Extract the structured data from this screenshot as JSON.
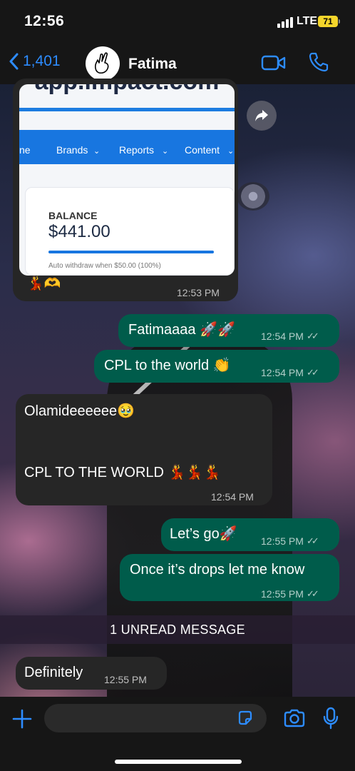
{
  "status_bar": {
    "time": "12:56",
    "network": "LTE",
    "battery": "71"
  },
  "header": {
    "back_count": "1,401",
    "contact_name": "Fatima"
  },
  "image_message": {
    "url_text": "app.impact.com",
    "nav": [
      "ne",
      "Brands",
      "Reports",
      "Content"
    ],
    "balance_label": "BALANCE",
    "balance_amount": "$441.00",
    "auto_withdraw": "Auto withdraw when $50.00 (100%)",
    "balance_progress": 1.0,
    "caption_emoji": "💃🫶",
    "time": "12:53 PM"
  },
  "messages": [
    {
      "dir": "out",
      "text": "Fatimaaaa 🚀🚀",
      "time": "12:54 PM"
    },
    {
      "dir": "out",
      "text": "CPL to the world 👏",
      "time": "12:54 PM"
    },
    {
      "dir": "in",
      "text": "Olamideeeeee🥹",
      "text2": "CPL TO THE WORLD 💃💃💃",
      "time": "12:54 PM"
    },
    {
      "dir": "out",
      "text": "Let’s go🚀",
      "time": "12:55 PM"
    },
    {
      "dir": "out",
      "text": "Once it’s drops let me know",
      "time": "12:55 PM"
    },
    {
      "dir": "in",
      "text": "Definitely",
      "time": "12:55 PM"
    }
  ],
  "unread_banner": "1 UNREAD MESSAGE",
  "composer": {
    "placeholder": ""
  },
  "colors": {
    "accent": "#2d8cff",
    "outgoing": "#005c4b",
    "incoming": "#262626"
  }
}
